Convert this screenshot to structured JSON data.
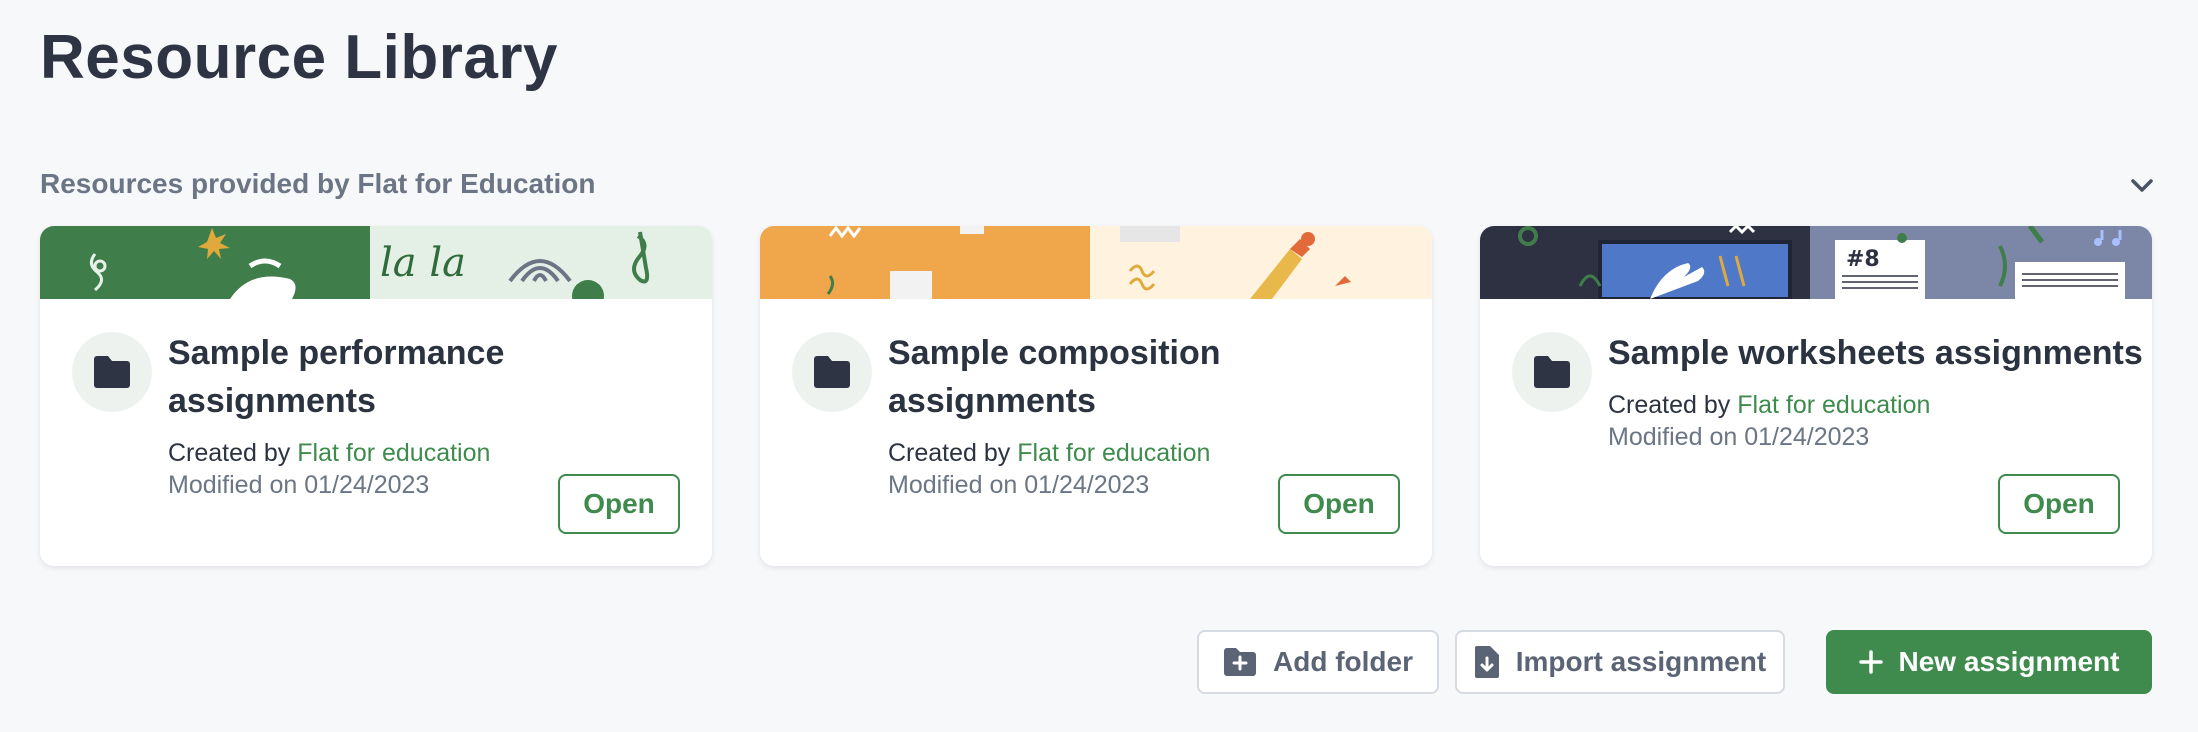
{
  "page": {
    "title": "Resource Library"
  },
  "section": {
    "title": "Resources provided by Flat for Education",
    "collapse_icon": "chevron-down-icon"
  },
  "cards": [
    {
      "title": "Sample performance assignments",
      "created_prefix": "Created by",
      "author": "Flat for education",
      "modified": "Modified on 01/24/2023",
      "open_label": "Open",
      "banner_text": "la la"
    },
    {
      "title": "Sample composition assignments",
      "created_prefix": "Created by",
      "author": "Flat for education",
      "modified": "Modified on 01/24/2023",
      "open_label": "Open"
    },
    {
      "title": "Sample worksheets assignments",
      "created_prefix": "Created by",
      "author": "Flat for education",
      "modified": "Modified on 01/24/2023",
      "open_label": "Open",
      "banner_text": "#8"
    }
  ],
  "actions": {
    "add_folder": "Add folder",
    "import_assignment": "Import assignment",
    "new_assignment": "New assignment"
  },
  "colors": {
    "accent": "#3f8a4d",
    "text": "#2b3240",
    "muted": "#6b7585",
    "background": "#f7f8fa"
  }
}
